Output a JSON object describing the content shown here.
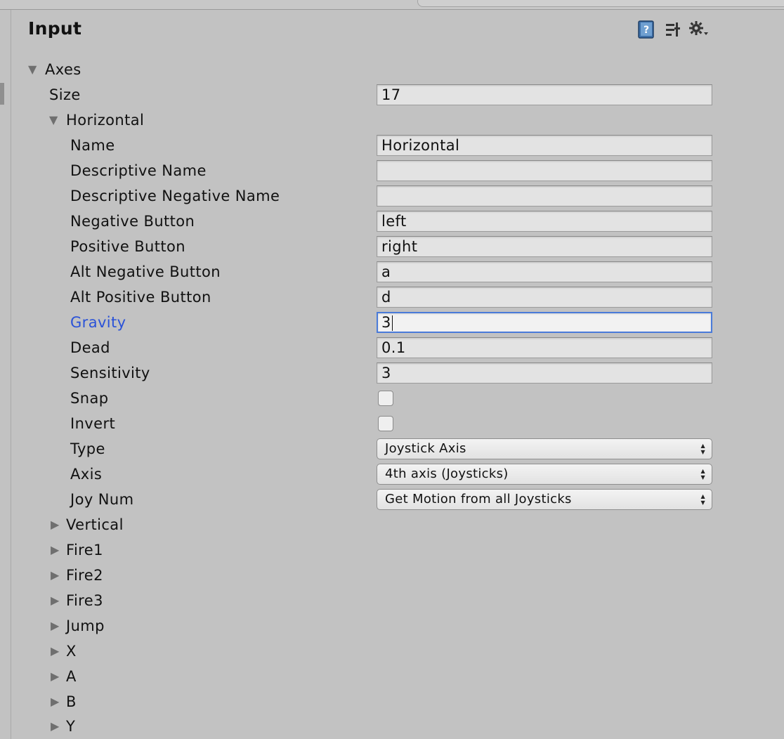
{
  "header": {
    "title": "Input"
  },
  "icons": {
    "help": "help-book-icon",
    "preset": "presets-icon",
    "settings": "gear-menu-icon"
  },
  "tree": {
    "axes_label": "Axes",
    "size_label": "Size",
    "size_value": "17",
    "horizontal_label": "Horizontal",
    "fields": {
      "name": {
        "label": "Name",
        "value": "Horizontal"
      },
      "descriptive_name": {
        "label": "Descriptive Name",
        "value": ""
      },
      "descriptive_negative_name": {
        "label": "Descriptive Negative Name",
        "value": ""
      },
      "negative_button": {
        "label": "Negative Button",
        "value": "left"
      },
      "positive_button": {
        "label": "Positive Button",
        "value": "right"
      },
      "alt_negative_button": {
        "label": "Alt Negative Button",
        "value": "a"
      },
      "alt_positive_button": {
        "label": "Alt Positive Button",
        "value": "d"
      },
      "gravity": {
        "label": "Gravity",
        "value": "3"
      },
      "dead": {
        "label": "Dead",
        "value": "0.1"
      },
      "sensitivity": {
        "label": "Sensitivity",
        "value": "3"
      },
      "snap": {
        "label": "Snap",
        "checked": false
      },
      "invert": {
        "label": "Invert",
        "checked": false
      },
      "type": {
        "label": "Type",
        "value": "Joystick Axis"
      },
      "axis": {
        "label": "Axis",
        "value": "4th axis (Joysticks)"
      },
      "joy_num": {
        "label": "Joy Num",
        "value": "Get Motion from all Joysticks"
      }
    },
    "collapsed": [
      "Vertical",
      "Fire1",
      "Fire2",
      "Fire3",
      "Jump",
      "X",
      "A",
      "B",
      "Y"
    ]
  },
  "colors": {
    "active_label": "#2a52d8",
    "focus_border": "#4a7bd9",
    "panel_bg": "#c2c2c2"
  }
}
